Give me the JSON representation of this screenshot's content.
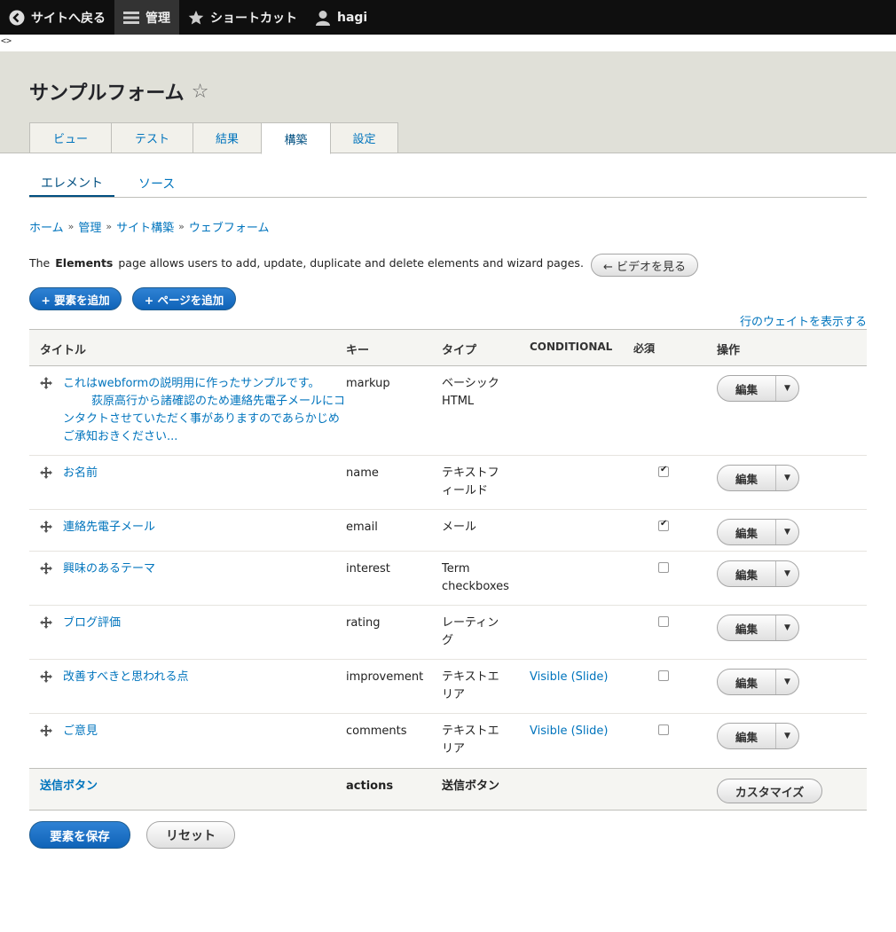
{
  "toolbar": {
    "back": "サイトへ戻る",
    "manage": "管理",
    "shortcuts": "ショートカット",
    "user": "hagi"
  },
  "debug_text": "<>",
  "page": {
    "title": "サンプルフォーム",
    "tabs": [
      "ビュー",
      "テスト",
      "結果",
      "構築",
      "設定"
    ],
    "active_tab": "構築",
    "subtabs": [
      "エレメント",
      "ソース"
    ],
    "active_subtab": "エレメント"
  },
  "breadcrumb": [
    "ホーム",
    "管理",
    "サイト構築",
    "ウェブフォーム"
  ],
  "breadcrumb_sep": "»",
  "description": {
    "prefix": "The",
    "bold": "Elements",
    "rest": "page allows users to add, update, duplicate and delete elements and wizard pages."
  },
  "video_button": "← ビデオを見る",
  "add_element_button": "+ 要素を追加",
  "add_page_button": "+ ページを追加",
  "show_weights_link": "行のウェイトを表示する",
  "table": {
    "headers": {
      "title": "タイトル",
      "key": "キー",
      "type": "タイプ",
      "conditional": "CONDITIONAL",
      "required": "必須",
      "operations": "操作"
    },
    "edit_label": "編集",
    "rows": [
      {
        "title_line1": "これはwebformの説明用に作ったサンプルです。",
        "title_line2": "荻原高行から諸確認のため連絡先電子メールにコ",
        "title_line3": "ンタクトさせていただく事がありますのであらかじめ",
        "title_line4": "ご承知おきください...",
        "key": "markup",
        "type_line1": "ベーシック",
        "type_line2": "HTML",
        "conditional": "",
        "required": null
      },
      {
        "title_line1": "お名前",
        "key": "name",
        "type_line1": "テキストフ",
        "type_line2": "ィールド",
        "conditional": "",
        "required": true
      },
      {
        "title_line1": "連絡先電子メール",
        "key": "email",
        "type_line1": "メール",
        "type_line2": "",
        "conditional": "",
        "required": true
      },
      {
        "title_line1": "興味のあるテーマ",
        "key": "interest",
        "type_line1": "Term",
        "type_line2": "checkboxes",
        "conditional": "",
        "required": false
      },
      {
        "title_line1": "ブログ評価",
        "key": "rating",
        "type_line1": "レーティン",
        "type_line2": "グ",
        "conditional": "",
        "required": false
      },
      {
        "title_line1": "改善すべきと思われる点",
        "key": "improvement",
        "type_line1": "テキストエ",
        "type_line2": "リア",
        "conditional": "Visible (Slide)",
        "required": false
      },
      {
        "title_line1": "ご意見",
        "key": "comments",
        "type_line1": "テキストエ",
        "type_line2": "リア",
        "conditional": "Visible (Slide)",
        "required": false
      }
    ],
    "footer": {
      "title": "送信ボタン",
      "key": "actions",
      "type": "送信ボタン",
      "customize": "カスタマイズ"
    }
  },
  "save_button": "要素を保存",
  "reset_button": "リセット",
  "colors": {
    "toolbar_bg": "#0f0f0f",
    "header_bg": "#e0e0d8",
    "link": "#0074bd",
    "primary": "#1b6fc0"
  }
}
